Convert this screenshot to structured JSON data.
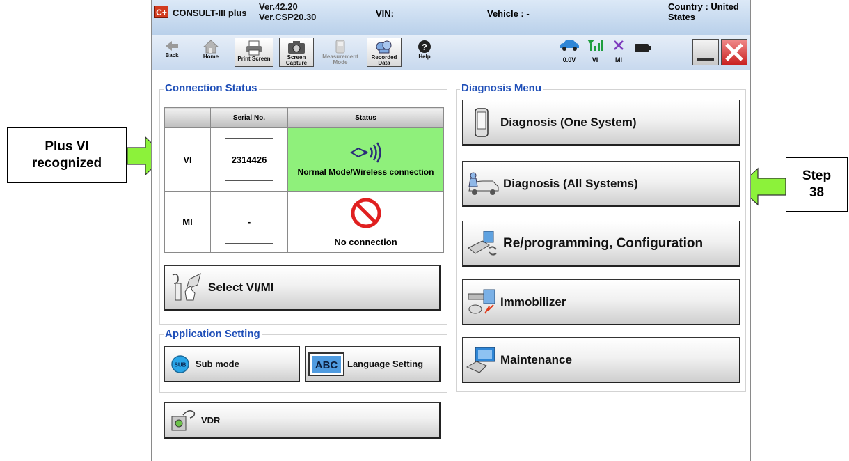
{
  "title_bar": {
    "app_name": "CONSULT-III plus",
    "logo_text": "C+",
    "version_line1": "Ver.42.20",
    "version_line2": "Ver.CSP20.30",
    "vin_label": "VIN:",
    "vehicle_label": "Vehicle : -",
    "country_label": "Country : United States"
  },
  "toolbar": {
    "back_label": "Back",
    "home_label": "Home",
    "print_screen_label": "Print Screen",
    "screen_capture_label": "Screen Capture",
    "measurement_mode_label": "Measurement Mode",
    "recorded_data_label": "Recorded Data",
    "help_label": "Help",
    "voltage_label": "0.0V",
    "vi_label": "VI",
    "mi_label": "MI"
  },
  "connection_status": {
    "title": "Connection Status",
    "col_serial": "Serial No.",
    "col_status": "Status",
    "rows": [
      {
        "device": "VI",
        "serial": "2314426",
        "status": "Normal Mode/Wireless connection"
      },
      {
        "device": "MI",
        "serial": "-",
        "status": "No connection"
      }
    ],
    "select_button": "Select VI/MI"
  },
  "application_setting": {
    "title": "Application Setting",
    "sub_mode": "Sub mode",
    "sub_icon_text": "SUB",
    "language_setting": "Language Setting",
    "abc_icon_text": "ABC"
  },
  "vdr_button": "VDR",
  "diagnosis_menu": {
    "title": "Diagnosis Menu",
    "items": [
      "Diagnosis (One System)",
      "Diagnosis (All Systems)",
      "Re/programming, Configuration",
      "Immobilizer",
      "Maintenance"
    ]
  },
  "callouts": {
    "left": "Plus VI recognized",
    "right": "Step 38"
  },
  "colors": {
    "group_title": "#1f4fb8",
    "status_ok": "#8ff07b",
    "arrow_green": "#8cf23a",
    "close_red": "#e23a3a"
  }
}
